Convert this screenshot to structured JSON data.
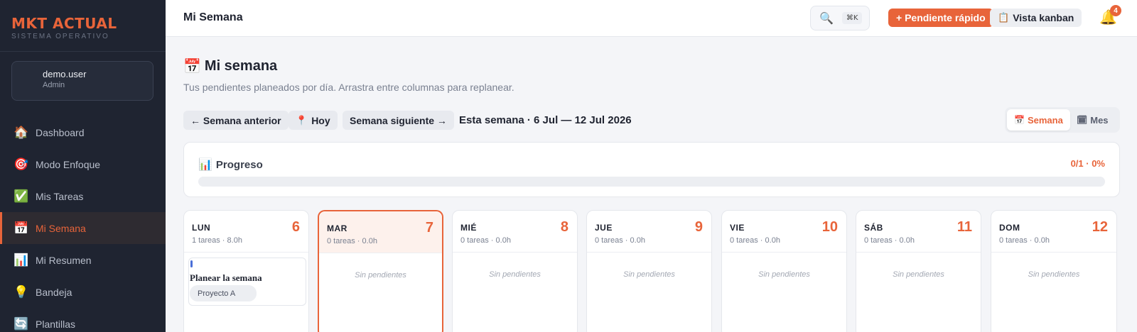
{
  "brand": {
    "title": "MKT ACTUAL",
    "subtitle": "SISTEMA OPERATIVO"
  },
  "user": {
    "name": "demo.user",
    "role": "Admin"
  },
  "sidebar": {
    "items": [
      {
        "label": "Dashboard",
        "icon": "🏠",
        "icon_name": "house-icon"
      },
      {
        "label": "Modo Enfoque",
        "icon": "🎯",
        "icon_name": "target-icon"
      },
      {
        "label": "Mis Tareas",
        "icon": "✅",
        "icon_name": "check-icon"
      },
      {
        "label": "Mi Semana",
        "icon": "📅",
        "icon_name": "calendar-icon",
        "active": true
      },
      {
        "label": "Mi Resumen",
        "icon": "📊",
        "icon_name": "bar-chart-icon"
      },
      {
        "label": "Bandeja",
        "icon": "💡",
        "icon_name": "lightbulb-icon"
      },
      {
        "label": "Plantillas",
        "icon": "🔄",
        "icon_name": "refresh-icon"
      }
    ]
  },
  "topbar": {
    "title": "Mi Semana",
    "search_icon": "🔍",
    "search_shortcut": "⌘K",
    "quick_button": "+ Pendiente rápido",
    "kanban_icon": "📋",
    "kanban_button": "Vista kanban",
    "bell_icon": "🔔",
    "notifications": "4"
  },
  "page": {
    "title_icon": "📅",
    "title": "Mi semana",
    "subtitle": "Tus pendientes planeados por día. Arrastra entre columnas para replanear."
  },
  "nav_controls": {
    "prev": "← Semana anterior",
    "today_icon": "📍",
    "today": "Hoy",
    "next": "Semana siguiente →",
    "range": "Esta semana · 6 Jul — 12 Jul 2026"
  },
  "view_toggle": {
    "week_icon": "📅",
    "week": "Semana",
    "month_icon": "🗓",
    "month": "Mes"
  },
  "progress": {
    "icon": "📊",
    "title": "Progreso",
    "value_text": "0/1 · 0%",
    "fraction": 0
  },
  "days": [
    {
      "name": "LUN",
      "number": "6",
      "meta": "1 tareas · 8.0h"
    },
    {
      "name": "MAR",
      "number": "7",
      "meta": "0 tareas · 0.0h",
      "today": true,
      "empty": "Sin pendientes"
    },
    {
      "name": "MIÉ",
      "number": "8",
      "meta": "0 tareas · 0.0h",
      "empty": "Sin pendientes"
    },
    {
      "name": "JUE",
      "number": "9",
      "meta": "0 tareas · 0.0h",
      "empty": "Sin pendientes"
    },
    {
      "name": "VIE",
      "number": "10",
      "meta": "0 tareas · 0.0h",
      "empty": "Sin pendientes"
    },
    {
      "name": "SÁB",
      "number": "11",
      "meta": "0 tareas · 0.0h",
      "empty": "Sin pendientes"
    },
    {
      "name": "DOM",
      "number": "12",
      "meta": "0 tareas · 0.0h",
      "empty": "Sin pendientes"
    }
  ],
  "task": {
    "title": "Planear la semana",
    "tag": "Proyecto A"
  },
  "colors": {
    "accent": "#e8643a",
    "sidebar_bg": "#1f2431",
    "task_accent": "#4a6fd8"
  }
}
